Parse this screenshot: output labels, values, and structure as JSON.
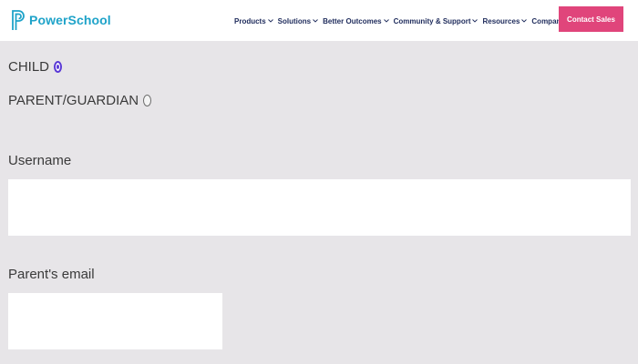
{
  "header": {
    "logo_text": "PowerSchool",
    "nav": [
      {
        "label": "Products"
      },
      {
        "label": "Solutions"
      },
      {
        "label": "Better Outcomes"
      },
      {
        "label": "Community & Support"
      },
      {
        "label": "Resources"
      },
      {
        "label": "Company"
      }
    ],
    "cta_label": "Contact Sales"
  },
  "form": {
    "role_options": [
      {
        "label": "CHILD",
        "selected": true
      },
      {
        "label": "PARENT/GUARDIAN",
        "selected": false
      }
    ],
    "username": {
      "label": "Username",
      "value": "",
      "placeholder": ""
    },
    "parent_email": {
      "label": "Parent's email",
      "value": "",
      "placeholder": ""
    }
  },
  "colors": {
    "brand": "#1fa3c9",
    "nav_text": "#1d2a5b",
    "cta_bg": "#e0457b",
    "radio_accent": "#5a39d6",
    "page_bg": "#e7e5e8"
  },
  "icons": {
    "logo": "powerschool-logo-icon",
    "dropdown": "chevron-down-icon"
  }
}
